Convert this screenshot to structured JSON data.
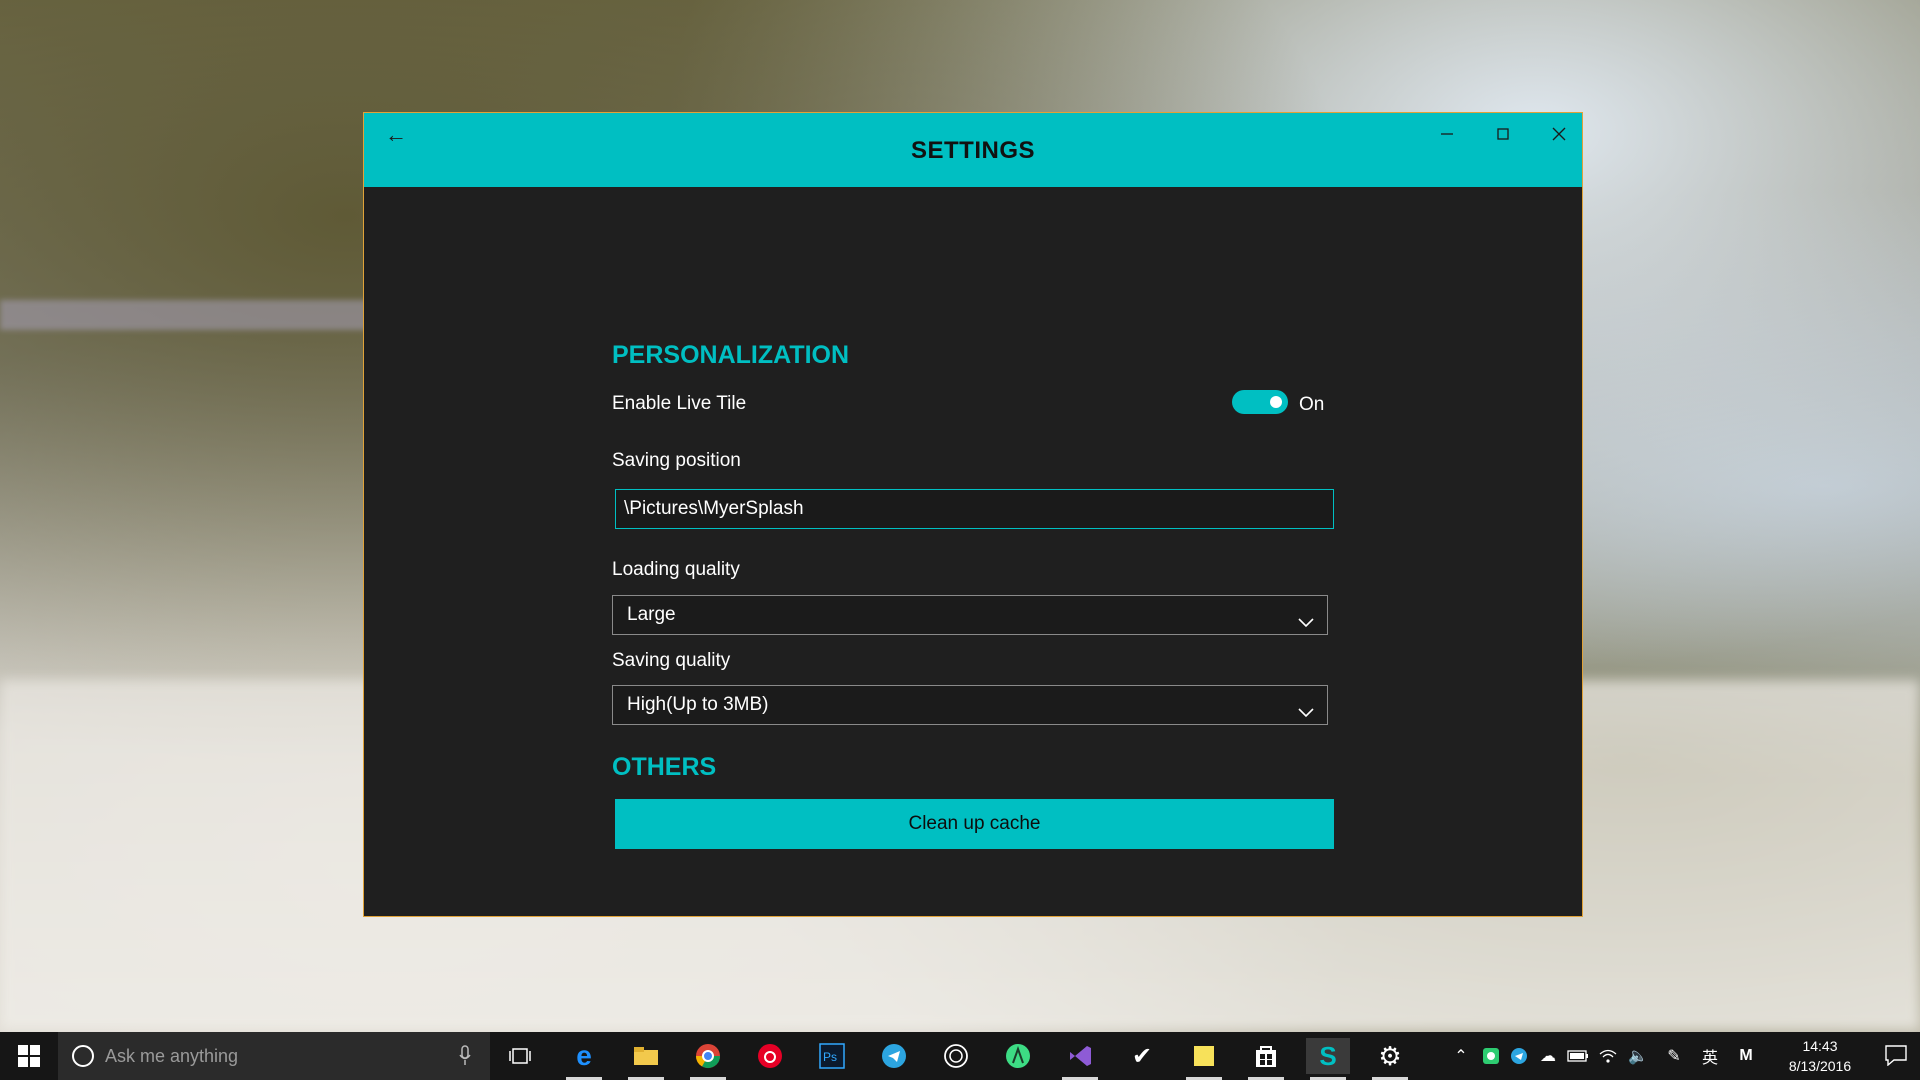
{
  "window": {
    "title": "SETTINGS",
    "accent_color": "#00bfc2",
    "border_color": "#e0a238"
  },
  "personalization": {
    "heading": "PERSONALIZATION",
    "live_tile": {
      "label": "Enable Live Tile",
      "state": "On"
    },
    "saving_position": {
      "label": "Saving position",
      "value": "\\Pictures\\MyerSplash"
    },
    "loading_quality": {
      "label": "Loading quality",
      "selected": "Large"
    },
    "saving_quality": {
      "label": "Saving quality",
      "selected": "High(Up to 3MB)"
    }
  },
  "others": {
    "heading": "OTHERS",
    "clean_button": "Clean up cache"
  },
  "taskbar": {
    "search_placeholder": "Ask me anything",
    "apps": [
      "task-view-icon",
      "edge-icon",
      "file-explorer-icon",
      "chrome-icon",
      "netease-music-icon",
      "photoshop-icon",
      "telegram-icon",
      "wordpress-icon",
      "android-studio-icon",
      "visual-studio-icon",
      "todo-check-icon",
      "sticky-notes-icon",
      "store-icon",
      "myersplash-icon",
      "settings-gear-icon"
    ],
    "ime_label": "英",
    "ime_mode": "M",
    "time": "14:43",
    "date": "8/13/2016"
  }
}
